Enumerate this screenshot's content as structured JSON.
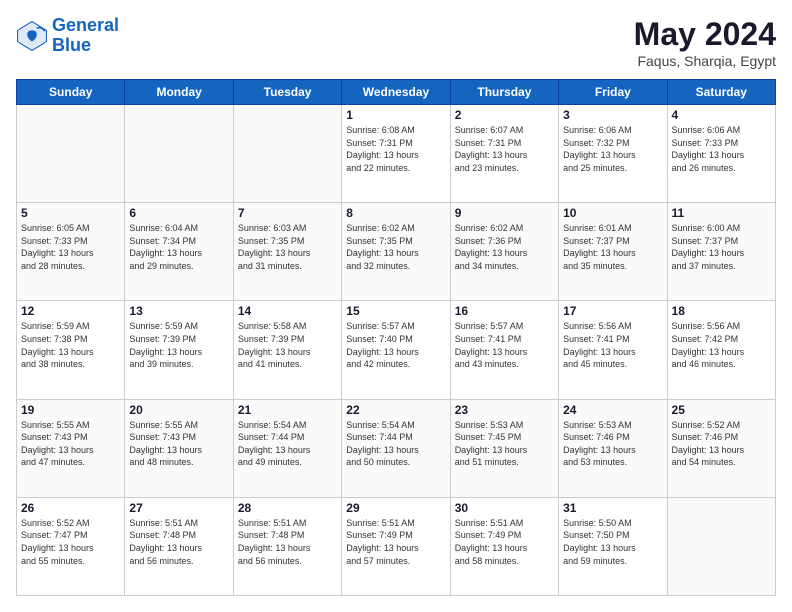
{
  "logo": {
    "line1": "General",
    "line2": "Blue"
  },
  "title": "May 2024",
  "subtitle": "Faqus, Sharqia, Egypt",
  "weekdays": [
    "Sunday",
    "Monday",
    "Tuesday",
    "Wednesday",
    "Thursday",
    "Friday",
    "Saturday"
  ],
  "weeks": [
    [
      {
        "day": "",
        "info": ""
      },
      {
        "day": "",
        "info": ""
      },
      {
        "day": "",
        "info": ""
      },
      {
        "day": "1",
        "info": "Sunrise: 6:08 AM\nSunset: 7:31 PM\nDaylight: 13 hours\nand 22 minutes."
      },
      {
        "day": "2",
        "info": "Sunrise: 6:07 AM\nSunset: 7:31 PM\nDaylight: 13 hours\nand 23 minutes."
      },
      {
        "day": "3",
        "info": "Sunrise: 6:06 AM\nSunset: 7:32 PM\nDaylight: 13 hours\nand 25 minutes."
      },
      {
        "day": "4",
        "info": "Sunrise: 6:06 AM\nSunset: 7:33 PM\nDaylight: 13 hours\nand 26 minutes."
      }
    ],
    [
      {
        "day": "5",
        "info": "Sunrise: 6:05 AM\nSunset: 7:33 PM\nDaylight: 13 hours\nand 28 minutes."
      },
      {
        "day": "6",
        "info": "Sunrise: 6:04 AM\nSunset: 7:34 PM\nDaylight: 13 hours\nand 29 minutes."
      },
      {
        "day": "7",
        "info": "Sunrise: 6:03 AM\nSunset: 7:35 PM\nDaylight: 13 hours\nand 31 minutes."
      },
      {
        "day": "8",
        "info": "Sunrise: 6:02 AM\nSunset: 7:35 PM\nDaylight: 13 hours\nand 32 minutes."
      },
      {
        "day": "9",
        "info": "Sunrise: 6:02 AM\nSunset: 7:36 PM\nDaylight: 13 hours\nand 34 minutes."
      },
      {
        "day": "10",
        "info": "Sunrise: 6:01 AM\nSunset: 7:37 PM\nDaylight: 13 hours\nand 35 minutes."
      },
      {
        "day": "11",
        "info": "Sunrise: 6:00 AM\nSunset: 7:37 PM\nDaylight: 13 hours\nand 37 minutes."
      }
    ],
    [
      {
        "day": "12",
        "info": "Sunrise: 5:59 AM\nSunset: 7:38 PM\nDaylight: 13 hours\nand 38 minutes."
      },
      {
        "day": "13",
        "info": "Sunrise: 5:59 AM\nSunset: 7:39 PM\nDaylight: 13 hours\nand 39 minutes."
      },
      {
        "day": "14",
        "info": "Sunrise: 5:58 AM\nSunset: 7:39 PM\nDaylight: 13 hours\nand 41 minutes."
      },
      {
        "day": "15",
        "info": "Sunrise: 5:57 AM\nSunset: 7:40 PM\nDaylight: 13 hours\nand 42 minutes."
      },
      {
        "day": "16",
        "info": "Sunrise: 5:57 AM\nSunset: 7:41 PM\nDaylight: 13 hours\nand 43 minutes."
      },
      {
        "day": "17",
        "info": "Sunrise: 5:56 AM\nSunset: 7:41 PM\nDaylight: 13 hours\nand 45 minutes."
      },
      {
        "day": "18",
        "info": "Sunrise: 5:56 AM\nSunset: 7:42 PM\nDaylight: 13 hours\nand 46 minutes."
      }
    ],
    [
      {
        "day": "19",
        "info": "Sunrise: 5:55 AM\nSunset: 7:43 PM\nDaylight: 13 hours\nand 47 minutes."
      },
      {
        "day": "20",
        "info": "Sunrise: 5:55 AM\nSunset: 7:43 PM\nDaylight: 13 hours\nand 48 minutes."
      },
      {
        "day": "21",
        "info": "Sunrise: 5:54 AM\nSunset: 7:44 PM\nDaylight: 13 hours\nand 49 minutes."
      },
      {
        "day": "22",
        "info": "Sunrise: 5:54 AM\nSunset: 7:44 PM\nDaylight: 13 hours\nand 50 minutes."
      },
      {
        "day": "23",
        "info": "Sunrise: 5:53 AM\nSunset: 7:45 PM\nDaylight: 13 hours\nand 51 minutes."
      },
      {
        "day": "24",
        "info": "Sunrise: 5:53 AM\nSunset: 7:46 PM\nDaylight: 13 hours\nand 53 minutes."
      },
      {
        "day": "25",
        "info": "Sunrise: 5:52 AM\nSunset: 7:46 PM\nDaylight: 13 hours\nand 54 minutes."
      }
    ],
    [
      {
        "day": "26",
        "info": "Sunrise: 5:52 AM\nSunset: 7:47 PM\nDaylight: 13 hours\nand 55 minutes."
      },
      {
        "day": "27",
        "info": "Sunrise: 5:51 AM\nSunset: 7:48 PM\nDaylight: 13 hours\nand 56 minutes."
      },
      {
        "day": "28",
        "info": "Sunrise: 5:51 AM\nSunset: 7:48 PM\nDaylight: 13 hours\nand 56 minutes."
      },
      {
        "day": "29",
        "info": "Sunrise: 5:51 AM\nSunset: 7:49 PM\nDaylight: 13 hours\nand 57 minutes."
      },
      {
        "day": "30",
        "info": "Sunrise: 5:51 AM\nSunset: 7:49 PM\nDaylight: 13 hours\nand 58 minutes."
      },
      {
        "day": "31",
        "info": "Sunrise: 5:50 AM\nSunset: 7:50 PM\nDaylight: 13 hours\nand 59 minutes."
      },
      {
        "day": "",
        "info": ""
      }
    ]
  ]
}
